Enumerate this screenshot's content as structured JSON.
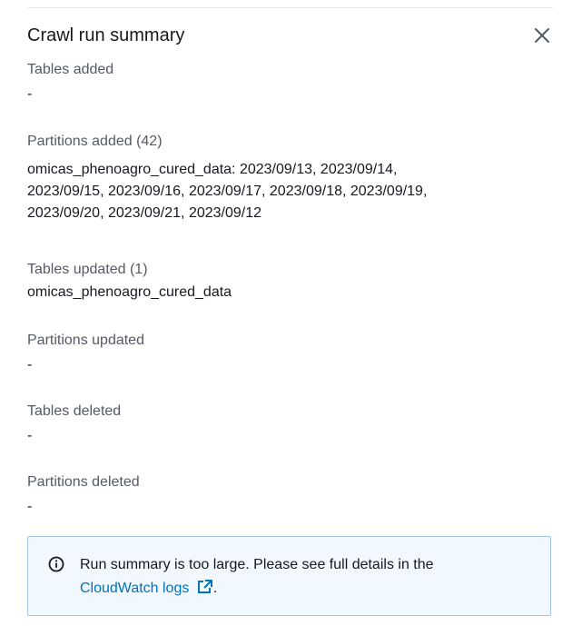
{
  "panel": {
    "title": "Crawl run summary",
    "close_icon": "close-icon"
  },
  "sections": {
    "tables_added": {
      "label": "Tables added",
      "value": "-"
    },
    "partitions_added": {
      "label": "Partitions added (42)",
      "lines": [
        "omicas_phenoagro_cured_data: 2023/09/13, 2023/09/14,",
        "2023/09/15, 2023/09/16, 2023/09/17, 2023/09/18, 2023/09/19,",
        "2023/09/20, 2023/09/21, 2023/09/12"
      ]
    },
    "tables_updated": {
      "label": "Tables updated (1)",
      "value": "omicas_phenoagro_cured_data"
    },
    "partitions_updated": {
      "label": "Partitions updated",
      "value": "-"
    },
    "tables_deleted": {
      "label": "Tables deleted",
      "value": "-"
    },
    "partitions_deleted": {
      "label": "Partitions deleted",
      "value": "-"
    }
  },
  "alert": {
    "icon": "info-icon",
    "text": "Run summary is too large. Please see full details in the",
    "link_label": "CloudWatch logs",
    "link_icon": "external-link-icon",
    "trailing": ".",
    "colors": {
      "border": "#a6c8e6",
      "background": "#f1f8fe",
      "link": "#0073bb"
    }
  }
}
